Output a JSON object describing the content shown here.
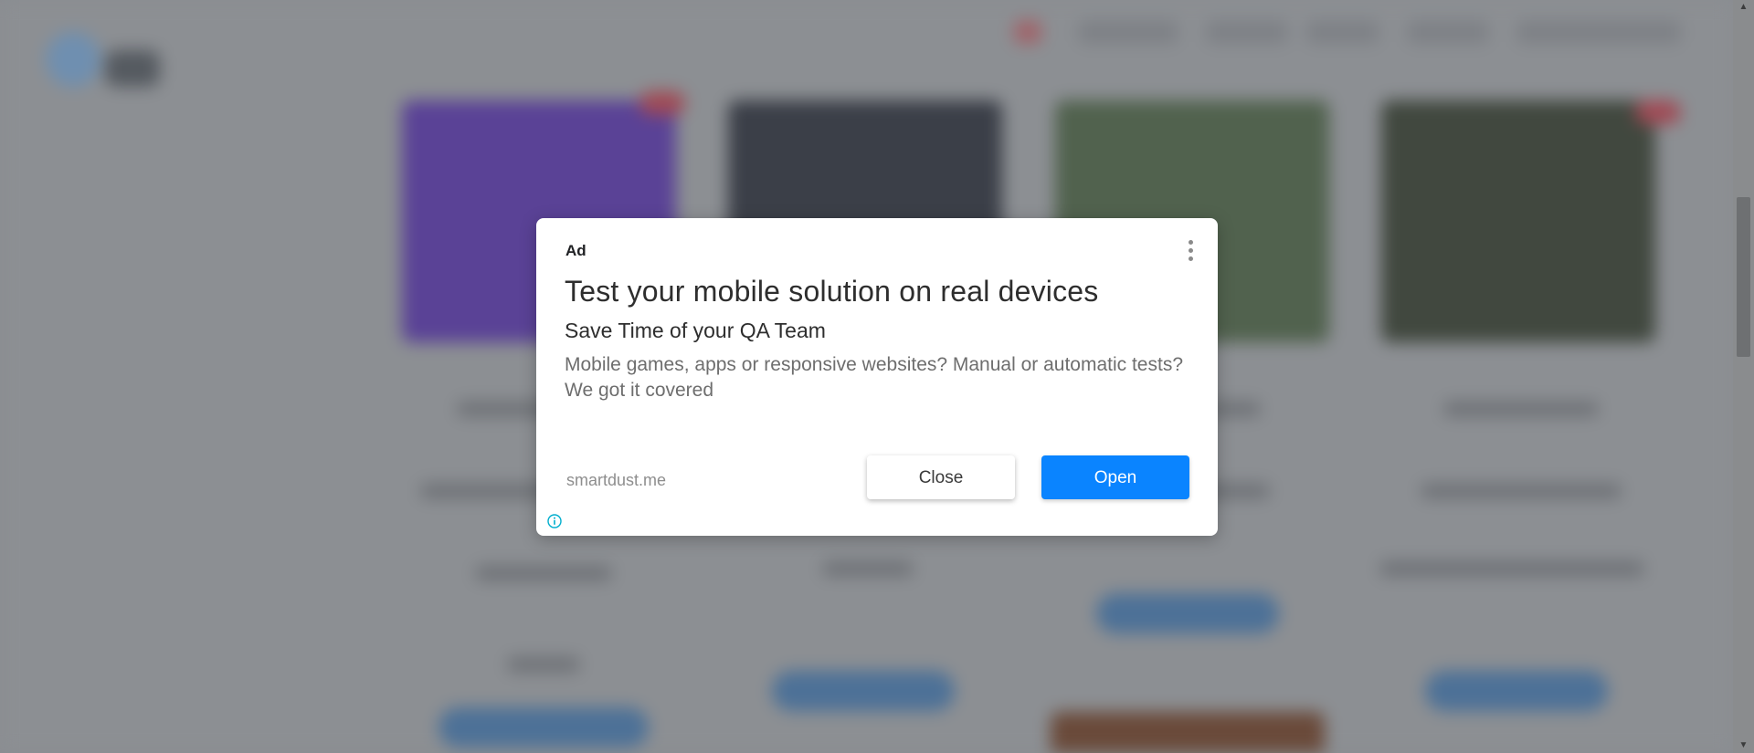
{
  "ad": {
    "label": "Ad",
    "headline": "Test your mobile solution on real devices",
    "subheadline": "Save Time of your QA Team",
    "description": "Mobile games, apps or responsive websites? Manual or automatic tests? We got it covered",
    "domain": "smartdust.me",
    "close_label": "Close",
    "open_label": "Open",
    "menu_icon": "more-vert-icon",
    "info_icon": "info-icon"
  },
  "colors": {
    "open_button": "#0a84ff",
    "overlay": "#8a8d91"
  },
  "icons": {
    "scroll_up": "scroll-up-arrow-icon",
    "scroll_down": "scroll-down-arrow-icon"
  }
}
